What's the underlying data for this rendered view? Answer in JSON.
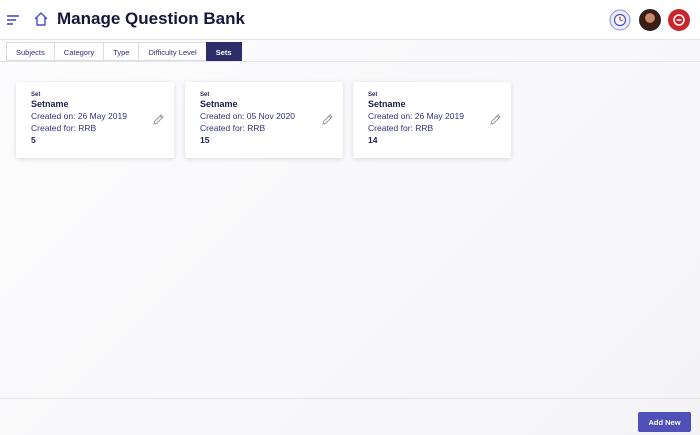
{
  "header": {
    "title": "Manage Question Bank",
    "icons": [
      "menu-icon",
      "home-icon",
      "alarm-clock-icon",
      "user-avatar",
      "app-logo-icon"
    ]
  },
  "tabs": [
    {
      "label": "Subjects",
      "active": false
    },
    {
      "label": "Category",
      "active": false
    },
    {
      "label": "Type",
      "active": false
    },
    {
      "label": "Difficulty Level",
      "active": false
    },
    {
      "label": "Sets",
      "active": true
    }
  ],
  "cards": [
    {
      "label": "Set",
      "name": "Setname",
      "created_on": "Created on: 26 May 2019",
      "created_for": "Created for: RRB",
      "count": "5"
    },
    {
      "label": "Set",
      "name": "Setname",
      "created_on": "Created on: 05 Nov 2020",
      "created_for": "Created for: RRB",
      "count": "15"
    },
    {
      "label": "Set",
      "name": "Setname",
      "created_on": "Created on: 26 May 2019",
      "created_for": "Created for: RRB",
      "count": "14"
    }
  ],
  "footer": {
    "add_label": "Add New"
  },
  "colors": {
    "accent": "#4f50b8",
    "active_tab": "#2c2d6b",
    "text_primary": "#1c1f55",
    "logo_red": "#c8252c"
  }
}
